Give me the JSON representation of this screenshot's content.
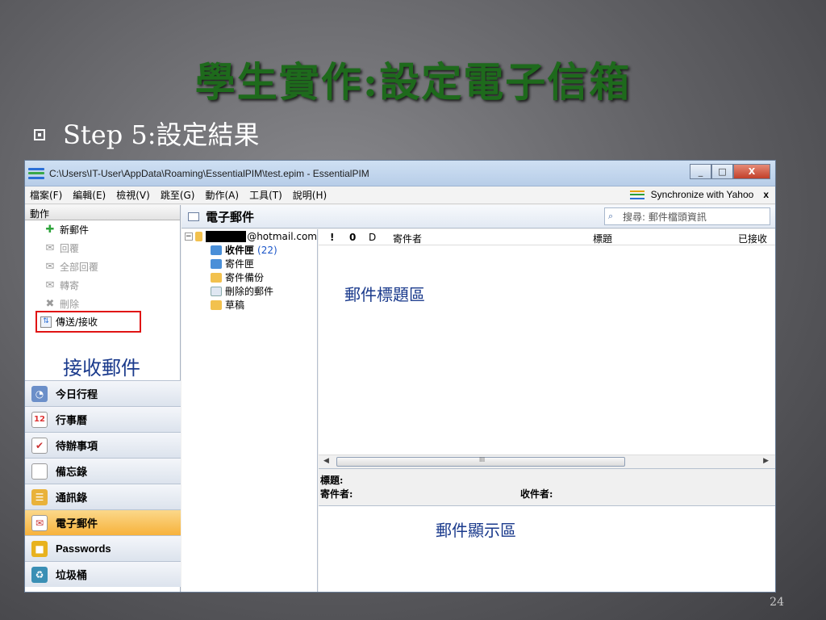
{
  "slide": {
    "title": "學生實作:設定電子信箱",
    "step": "Step 5:設定結果",
    "page_number": "24"
  },
  "window": {
    "title": "C:\\Users\\IT-User\\AppData\\Roaming\\EssentialPIM\\test.epim - EssentialPIM",
    "minimize": "_",
    "maximize": "□",
    "close": "X"
  },
  "menu": {
    "items": [
      "檔案(F)",
      "編輯(E)",
      "檢視(V)",
      "跳至(G)",
      "動作(A)",
      "工具(T)",
      "說明(H)"
    ],
    "sync_label": "Synchronize with Yahoo",
    "sync_close": "x"
  },
  "actions": {
    "header": "動作",
    "new_mail": "新郵件",
    "reply": "回覆",
    "reply_all": "全部回覆",
    "forward": "轉寄",
    "delete": "刪除",
    "send_receive": "傳送/接收",
    "receive_caption": "接收郵件"
  },
  "nav": {
    "items": [
      "今日行程",
      "行事曆",
      "待辦事項",
      "備忘錄",
      "通訊錄",
      "電子郵件",
      "Passwords",
      "垃圾桶"
    ],
    "active": "電子郵件",
    "calendar_day": "12"
  },
  "mail": {
    "header": "電子郵件",
    "search_placeholder": "搜尋: 郵件檔頭資訊",
    "account_suffix": "@hotmail.com",
    "folders": {
      "inbox": "收件匣",
      "inbox_count": "(22)",
      "outbox": "寄件匣",
      "sent": "寄件備份",
      "deleted": "刪除的郵件",
      "drafts": "草稿"
    },
    "columns": {
      "importance": "!",
      "attachment": "0",
      "type": "D",
      "sender": "寄件者",
      "subject": "標題",
      "received": "已接收"
    },
    "list_caption": "郵件標題區",
    "scroll_grip": "III",
    "preview": {
      "subject_label": "標題:",
      "from_label": "寄件者:",
      "to_label": "收件者:",
      "caption": "郵件顯示區"
    }
  }
}
